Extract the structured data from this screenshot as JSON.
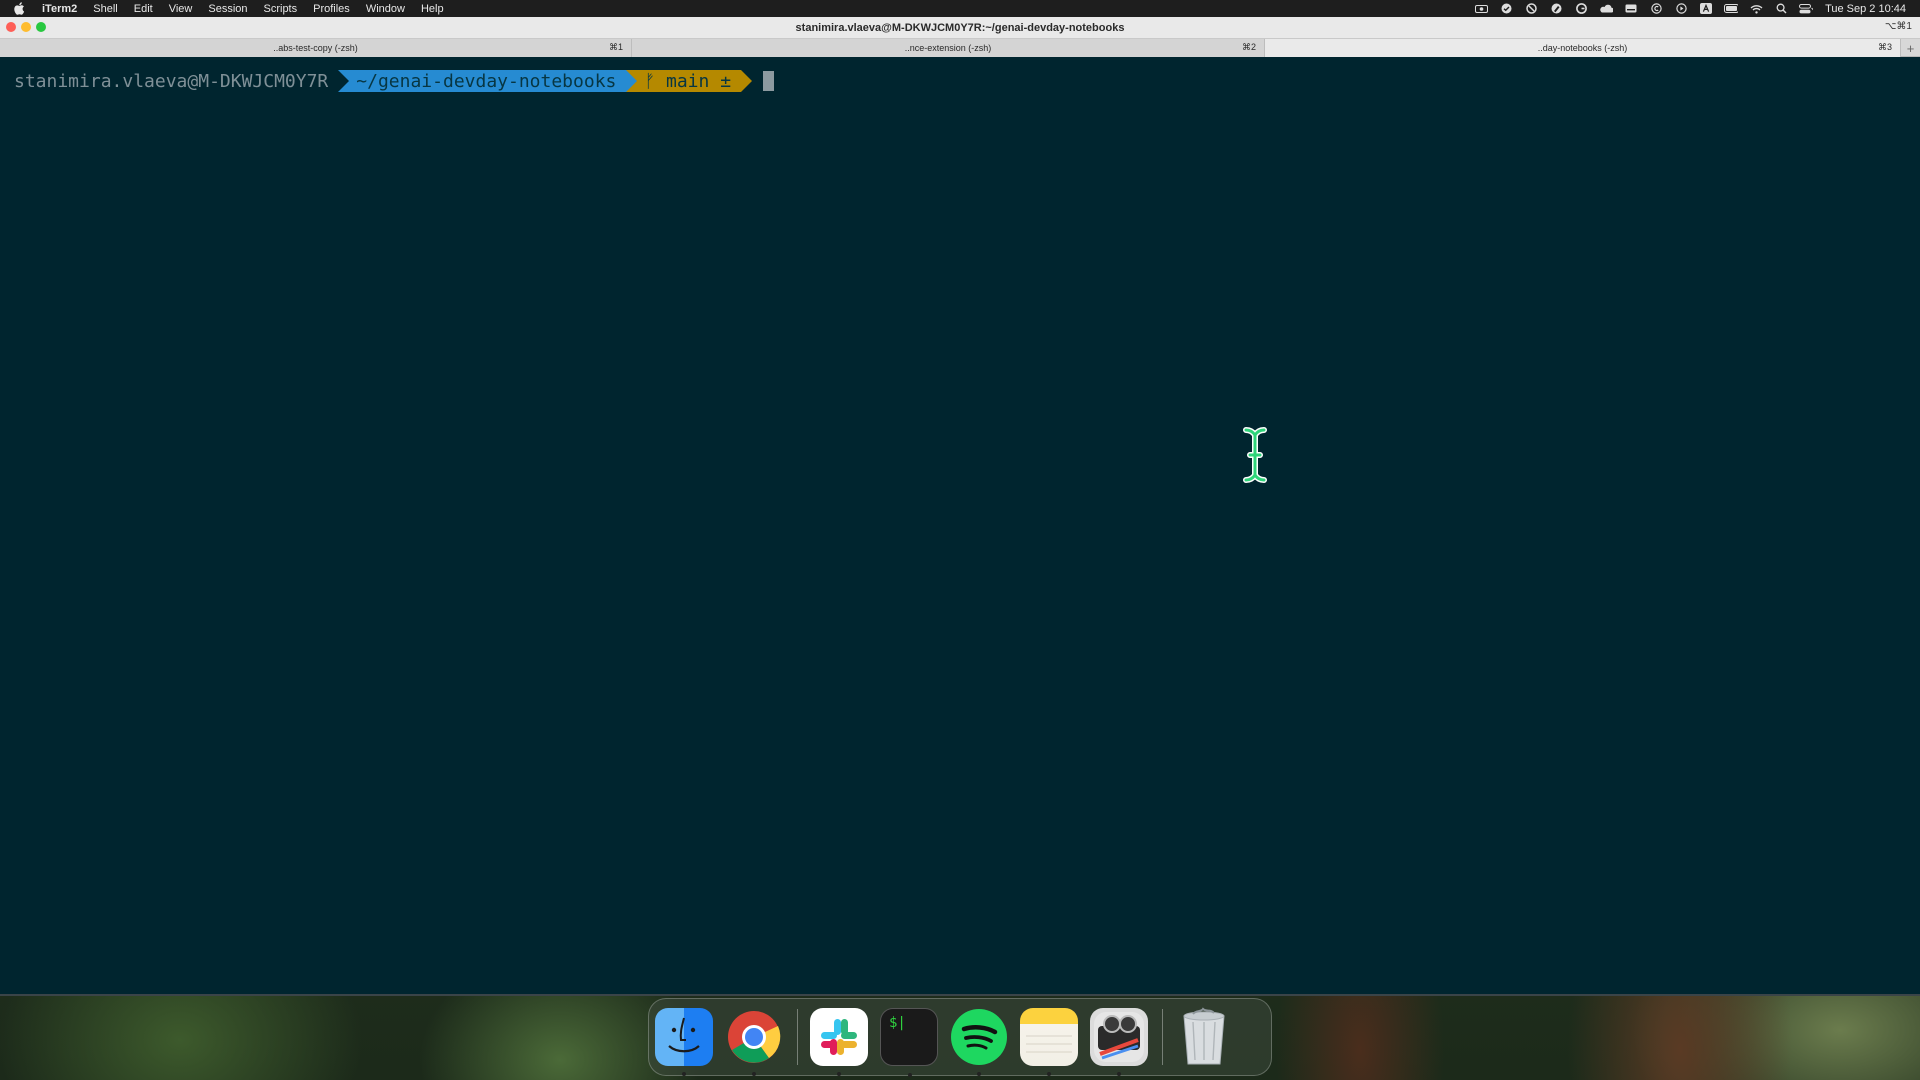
{
  "menubar": {
    "app_name": "iTerm2",
    "items": [
      "Shell",
      "Edit",
      "View",
      "Session",
      "Scripts",
      "Profiles",
      "Window",
      "Help"
    ],
    "clock": "Tue Sep 2  10:44"
  },
  "window": {
    "title": "stanimira.vlaeva@M-DKWJCM0Y7R:~/genai-devday-notebooks",
    "shortcut": "⌥⌘1",
    "tabs": [
      {
        "title": "..abs-test-copy (-zsh)",
        "key": "⌘1"
      },
      {
        "title": "..nce-extension (-zsh)",
        "key": "⌘2"
      },
      {
        "title": "..day-notebooks (-zsh)",
        "key": "⌘3"
      }
    ],
    "new_tab": "+"
  },
  "prompt": {
    "user_host": "stanimira.vlaeva@M-DKWJCM0Y7R",
    "directory": "~/genai-devday-notebooks",
    "git_branch": "ᚠ main ±"
  },
  "colors": {
    "terminal_bg": "#00252f",
    "dir_segment": "#268bd2",
    "git_segment": "#b58900"
  },
  "dock": {
    "apps": [
      "finder-icon",
      "chrome-icon",
      "slack-icon",
      "terminal-icon",
      "spotify-icon",
      "notes-icon",
      "photo-booth-icon",
      "trash-icon"
    ],
    "terminal_glyph": "$|"
  }
}
